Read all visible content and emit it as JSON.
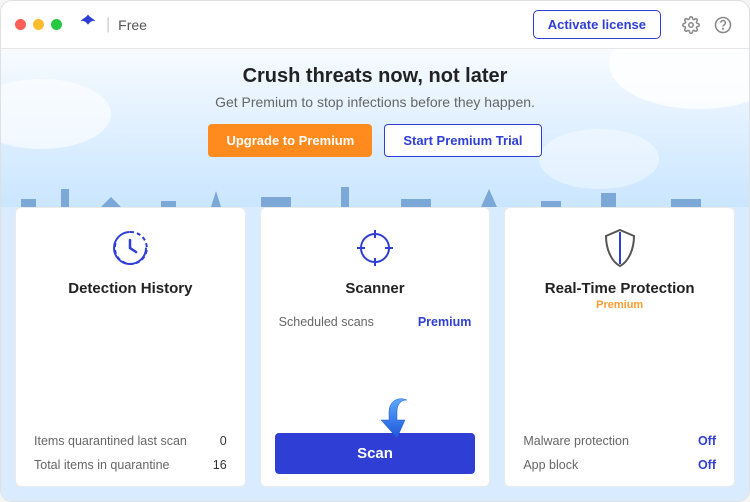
{
  "titlebar": {
    "plan_label": "Free",
    "activate_label": "Activate license"
  },
  "hero": {
    "headline": "Crush threats now, not later",
    "subhead": "Get Premium to stop infections before they happen.",
    "upgrade_label": "Upgrade to Premium",
    "trial_label": "Start Premium Trial"
  },
  "cards": {
    "history": {
      "title": "Detection History",
      "rows": [
        {
          "label": "Items quarantined last scan",
          "value": "0"
        },
        {
          "label": "Total items in quarantine",
          "value": "16"
        }
      ]
    },
    "scanner": {
      "title": "Scanner",
      "rows": [
        {
          "label": "Scheduled scans",
          "value": "Premium"
        }
      ],
      "scan_label": "Scan"
    },
    "realtime": {
      "title": "Real-Time Protection",
      "badge": "Premium",
      "rows": [
        {
          "label": "Malware protection",
          "value": "Off"
        },
        {
          "label": "App block",
          "value": "Off"
        }
      ]
    }
  }
}
